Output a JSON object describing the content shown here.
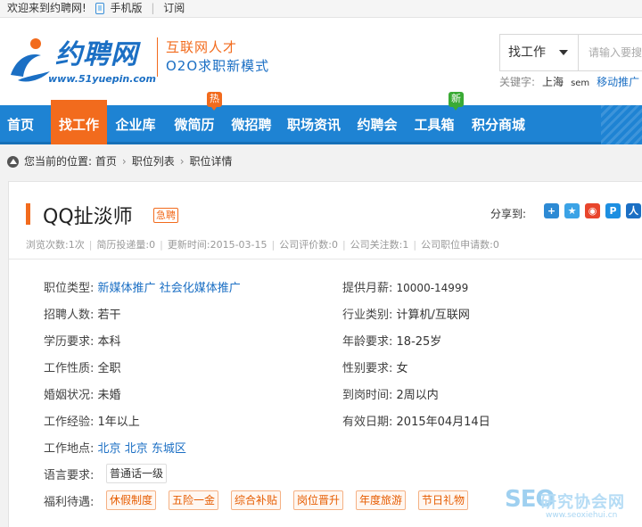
{
  "topbar": {
    "welcome": "欢迎来到约聘网!",
    "mobile": "手机版",
    "subscribe": "订阅"
  },
  "header": {
    "logo_text": "约聘网",
    "logo_url": "www.51yuepin.com",
    "slogan_line1": "互联网人才",
    "slogan_line2": "O2O求职新模式"
  },
  "search": {
    "type_selected": "找工作",
    "placeholder": "请输入要搜索",
    "keywords_label": "关键字:",
    "keywords": [
      "上海",
      "sem",
      "移动推广"
    ]
  },
  "nav": {
    "items": [
      {
        "label": "首页"
      },
      {
        "label": "找工作"
      },
      {
        "label": "企业库"
      },
      {
        "label": "微简历",
        "badge": "热"
      },
      {
        "label": "微招聘"
      },
      {
        "label": "职场资讯"
      },
      {
        "label": "约聘会"
      },
      {
        "label": "工具箱",
        "badge": "新"
      },
      {
        "label": "积分商城"
      }
    ],
    "active": "找工作"
  },
  "breadcrumb": {
    "prefix": "您当前的位置:",
    "items": [
      "首页",
      "职位列表",
      "职位详情"
    ]
  },
  "job": {
    "title": "QQ扯淡师",
    "urgent_badge": "急聘",
    "share_label": "分享到:",
    "stats": {
      "views": "浏览次数:1次",
      "resumes": "简历投递量:0",
      "updated": "更新时间:2015-03-15",
      "rating": "公司评价数:0",
      "follows": "公司关注数:1",
      "applications": "公司职位申请数:0"
    },
    "fields": {
      "type_label": "职位类型:",
      "type_values": [
        "新媒体推广",
        "社会化媒体推广"
      ],
      "salary_label": "提供月薪:",
      "salary": "10000-14999",
      "headcount_label": "招聘人数:",
      "headcount": "若干",
      "industry_label": "行业类别:",
      "industry": "计算机/互联网",
      "education_label": "学历要求:",
      "education": "本科",
      "age_label": "年龄要求:",
      "age": "18-25岁",
      "nature_label": "工作性质:",
      "nature": "全职",
      "gender_label": "性别要求:",
      "gender": "女",
      "marital_label": "婚姻状况:",
      "marital": "未婚",
      "arrival_label": "到岗时间:",
      "arrival": "2周以内",
      "experience_label": "工作经验:",
      "experience": "1年以上",
      "valid_label": "有效日期:",
      "valid": "2015年04月14日",
      "location_label": "工作地点:",
      "location": [
        "北京",
        "北京",
        "东城区"
      ],
      "language_label": "语言要求:",
      "language": "普通话一级",
      "welfare_label": "福利待遇:",
      "welfare": [
        "休假制度",
        "五险一金",
        "综合补贴",
        "岗位晋升",
        "年度旅游",
        "节日礼物"
      ]
    }
  },
  "watermark": {
    "seo": "SEO",
    "cn": "研究协会网",
    "url": "www.seoxiehui.cn"
  }
}
